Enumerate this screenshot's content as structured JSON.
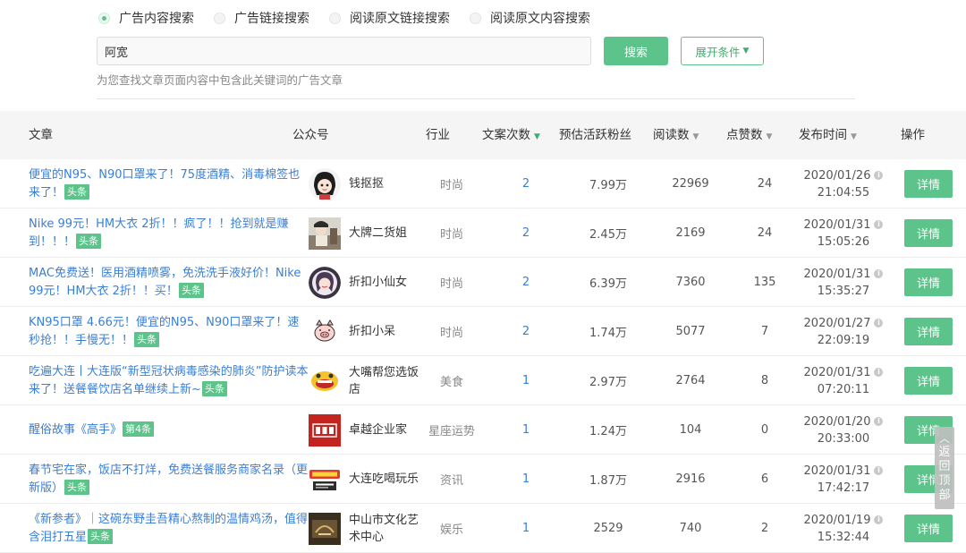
{
  "search": {
    "modes": [
      "广告内容搜索",
      "广告链接搜索",
      "阅读原文链接搜索",
      "阅读原文内容搜索"
    ],
    "selected_mode_index": 0,
    "query": "阿宽",
    "search_label": "搜索",
    "expand_label": "展开条件",
    "hint": "为您查找文章页面内容中包含此关键词的广告文章"
  },
  "table": {
    "columns": {
      "article": "文章",
      "account": "公众号",
      "industry": "行业",
      "count": "文案次数",
      "fans": "预估活跃粉丝",
      "reads": "阅读数",
      "likes": "点赞数",
      "date": "发布时间",
      "action": "操作"
    },
    "detail_label": "详情",
    "rows": [
      {
        "title": "便宜的N95、N90口罩来了！75度酒精、消毒棉签也来了！",
        "tag": "头条",
        "avatar": "girl",
        "account": "钱抠抠",
        "industry": "时尚",
        "count": "2",
        "fans": "7.99万",
        "reads": "22969",
        "likes": "24",
        "date": "2020/01/26",
        "time": "21:04:55"
      },
      {
        "title": "Nike 99元！HM大衣 2折！！疯了！！抢到就是赚到！！！",
        "tag": "头条",
        "avatar": "photo",
        "account": "大牌二货姐",
        "industry": "时尚",
        "count": "2",
        "fans": "2.45万",
        "reads": "2169",
        "likes": "24",
        "date": "2020/01/31",
        "time": "15:05:26"
      },
      {
        "title": "MAC免费送！医用酒精喷雾，免洗洗手液好价！Nike 99元！HM大衣 2折！！买！",
        "tag": "头条",
        "avatar": "woman",
        "account": "折扣小仙女",
        "industry": "时尚",
        "count": "2",
        "fans": "6.39万",
        "reads": "7360",
        "likes": "135",
        "date": "2020/01/31",
        "time": "15:35:27"
      },
      {
        "title": "KN95口罩 4.66元！便宜的N95、N90口罩来了！速秒抢！！手慢无！！",
        "tag": "头条",
        "avatar": "pig",
        "account": "折扣小呆",
        "industry": "时尚",
        "count": "2",
        "fans": "1.74万",
        "reads": "5077",
        "likes": "7",
        "date": "2020/01/27",
        "time": "22:09:19"
      },
      {
        "title": "吃遍大连丨大连版“新型冠状病毒感染的肺炎”防护读本来了！送餐餐饮店名单继续上新~",
        "tag": "头条",
        "avatar": "mouth",
        "account": "大嘴帮您选饭店",
        "industry": "美食",
        "count": "1",
        "fans": "2.97万",
        "reads": "2764",
        "likes": "8",
        "date": "2020/01/31",
        "time": "07:20:11"
      },
      {
        "title": "醒俗故事《高手》",
        "tag": "第4条",
        "avatar": "red",
        "account": "卓越企业家",
        "industry": "星座运势",
        "count": "1",
        "fans": "1.24万",
        "reads": "104",
        "likes": "0",
        "date": "2020/01/20",
        "time": "20:33:00"
      },
      {
        "title": "春节宅在家，饭店不打烊，免费送餐服务商家名录（更新版）",
        "tag": "头条",
        "avatar": "radio",
        "account": "大连吃喝玩乐",
        "industry": "资讯",
        "count": "1",
        "fans": "1.87万",
        "reads": "2916",
        "likes": "6",
        "date": "2020/01/31",
        "time": "17:42:17"
      },
      {
        "title": "《新参者》｜这碗东野圭吾精心熬制的温情鸡汤，值得含泪打五星",
        "tag": "头条",
        "avatar": "dark",
        "account": "中山市文化艺术中心",
        "industry": "娱乐",
        "count": "1",
        "fans": "2529",
        "reads": "740",
        "likes": "2",
        "date": "2020/01/19",
        "time": "15:32:44"
      }
    ]
  },
  "back_to_top": "返回顶部",
  "colors": {
    "accent": "#5cc48a",
    "link": "#3a7fd5"
  }
}
